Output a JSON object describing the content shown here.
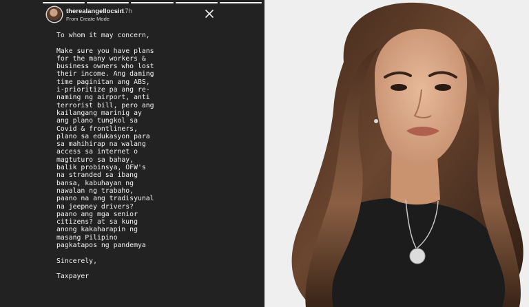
{
  "story": {
    "username": "therealangellocsin",
    "timestamp": "17h",
    "subline": "From Create Mode",
    "progress": [
      1,
      1,
      1,
      1,
      1
    ],
    "close_icon": "close-icon",
    "text": {
      "greeting": "To whom it may concern,",
      "body": "Make sure you have plans\nfor the many workers &\nbusiness owners who lost\ntheir income. Ang daming\ntime paginitan ang ABS,\ni-prioritize pa ang re-\nnaming ng airport, anti\nterrorist bill, pero ang\nkailangang marinig ay\nang plano tungkol sa\nCovid & frontliners,\nplano sa edukasyon para\nsa mahihirap na walang\naccess sa internet o\nmagtuturo sa bahay,\nbalik probinsya, OFW's\nna stranded sa ibang\nbansa, kabuhayan ng\nnawalan ng trabaho,\npaano na ang tradisyunal\nna jeepney drivers?\npaano ang mga senior\ncitizens? at sa kung\nanong kakaharapin ng\nmasang Pilipino\npagkatapos ng pandemya",
      "closing": "Sincerely,",
      "signature": "Taxpayer"
    }
  },
  "photo": {
    "background_color": "#efefef",
    "hair_color": "#5a3a26",
    "top_color": "#1c1c1c"
  }
}
